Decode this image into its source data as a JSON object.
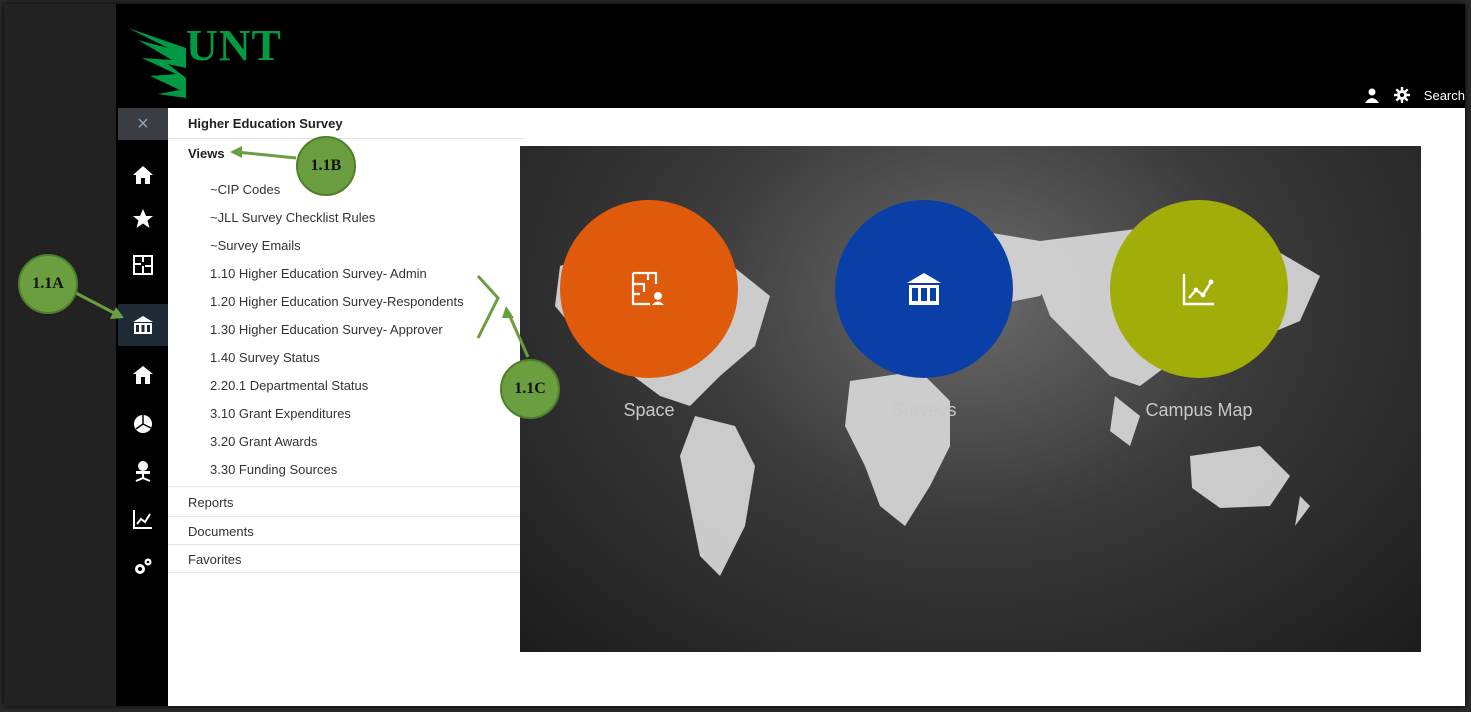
{
  "brand": {
    "logo_text": "UNT",
    "accent": "#009a44"
  },
  "header": {
    "search_label": "Search",
    "user_icon": "user-icon",
    "settings_icon": "gear-icon"
  },
  "rail": {
    "close": "×",
    "items": [
      "home-icon",
      "star-icon",
      "floorplan-icon",
      "building-icon",
      "house-icon",
      "pie-chart-icon",
      "office-chair-icon",
      "line-chart-icon",
      "gears-icon"
    ]
  },
  "nav": {
    "title": "Higher Education Survey",
    "views_label": "Views",
    "views": [
      "~CIP Codes",
      "~JLL Survey Checklist Rules",
      "~Survey Emails",
      "1.10 Higher Education Survey- Admin",
      "1.20 Higher Education Survey-Respondents",
      "1.30 Higher Education Survey- Approver",
      "1.40 Survey Status",
      "2.20.1 Departmental Status",
      "3.10 Grant Expenditures",
      "3.20 Grant Awards",
      "3.30 Funding Sources"
    ],
    "sections": [
      "Reports",
      "Documents",
      "Favorites"
    ]
  },
  "tiles": [
    {
      "label": "Space",
      "color": "#e05a0c",
      "icon": "floorplan-icon"
    },
    {
      "label": "Surveys",
      "color": "#0a3fa8",
      "icon": "building-icon"
    },
    {
      "label": "Campus Map",
      "color": "#a3ad0a",
      "icon": "line-chart-icon"
    }
  ],
  "annotations": {
    "a": "1.1A",
    "b": "1.1B",
    "c": "1.1C",
    "color": "#6a9e3f"
  }
}
